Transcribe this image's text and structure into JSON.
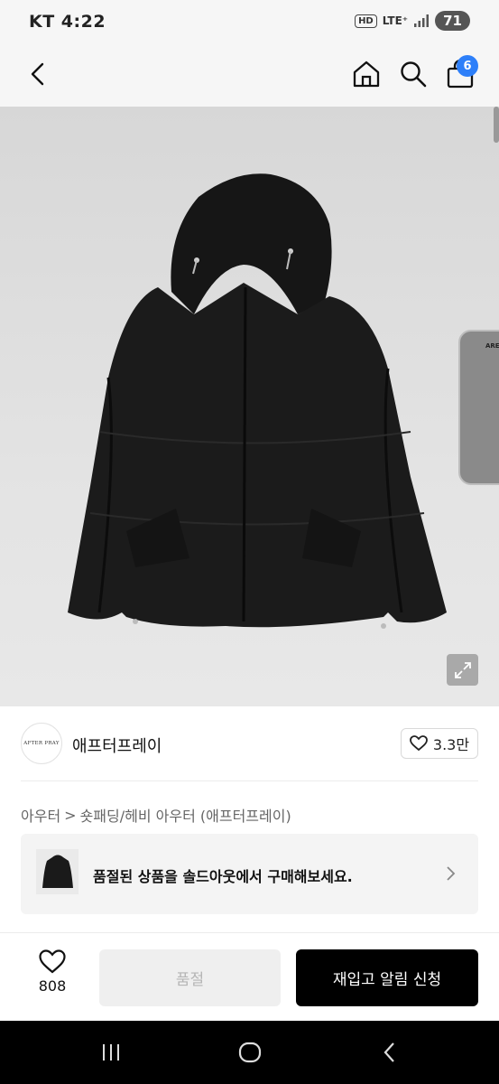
{
  "status_bar": {
    "carrier_time": "KT 4:22",
    "hd": "HD",
    "network": "LTE⁺",
    "battery": "71"
  },
  "header": {
    "cart_count": "6",
    "icons": [
      "chevron-left-icon",
      "home-icon",
      "search-icon",
      "shopping-bag-icon"
    ]
  },
  "product": {
    "preview_label": "AREA"
  },
  "brand": {
    "logo_text": "AFTER PRAY",
    "name": "애프터프레이",
    "likes": "3.3만"
  },
  "breadcrumb": {
    "category": "아우터",
    "separator": ">",
    "subcategory": "숏패딩/헤비 아우터 (애프터프레이)"
  },
  "banner": {
    "text": "품절된 상품을 솔드아웃에서 구매해보세요."
  },
  "actions": {
    "wish_count": "808",
    "soldout_label": "품절",
    "restock_label": "재입고 알림 신청"
  },
  "colors": {
    "accent": "#2d7ff9",
    "primary_button": "#000000",
    "disabled_button": "#efefef"
  }
}
